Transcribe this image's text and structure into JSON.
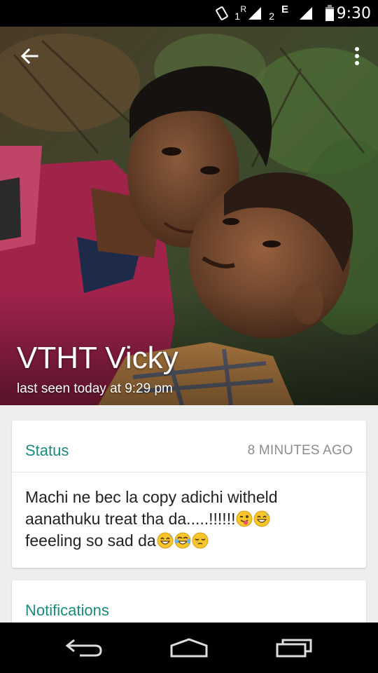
{
  "status_bar": {
    "time": "9:30",
    "sim1_label": "1",
    "roaming_label": "R",
    "sim2_label": "2",
    "network_type": "E",
    "icons": [
      "vibrate-icon",
      "signal-icon",
      "signal-icon",
      "battery-icon"
    ]
  },
  "header": {
    "contact_name": "VTHT Vicky",
    "last_seen": "last seen today at 9:29 pm",
    "back_icon": "arrow-left-icon",
    "menu_icon": "more-vert-icon"
  },
  "status_card": {
    "title": "Status",
    "time": "8 MINUTES AGO",
    "line1": "Machi ne bec la copy adichi witheld",
    "line2": "aanathuku treat tha da.....!!!!!!",
    "line3": "feeeling so sad da",
    "emojis_line2": [
      "winking-tongue-emoji",
      "grinning-sweat-emoji"
    ],
    "emojis_line3": [
      "grinning-sweat-emoji",
      "tears-of-joy-emoji",
      "sleepy-emoji"
    ]
  },
  "notifications_card": {
    "title": "Notifications"
  },
  "nav_bar": {
    "icons": [
      "back-icon",
      "home-icon",
      "recents-icon"
    ]
  },
  "colors": {
    "accent": "#1a8a7c",
    "muted_text": "#8d8d8d",
    "background": "#eeeeee"
  }
}
